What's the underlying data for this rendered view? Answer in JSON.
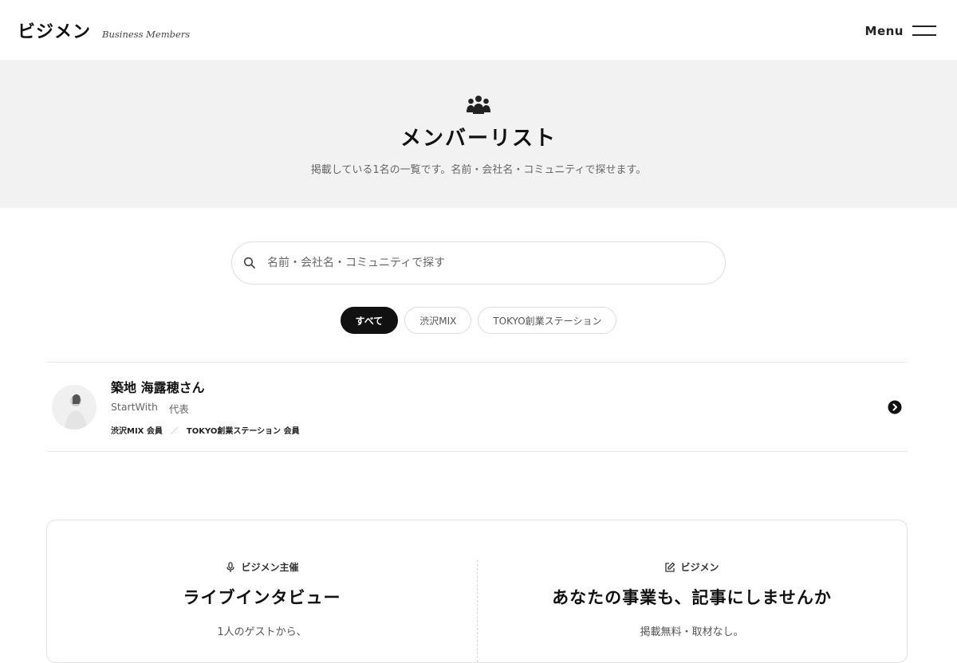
{
  "header": {
    "logo": "ビジメン",
    "tagline": "Business Members",
    "menu_label": "Menu"
  },
  "hero": {
    "title": "メンバーリスト",
    "subtitle": "掲載している1名の一覧です。名前・会社名・コミュニティで探せます。"
  },
  "search": {
    "placeholder": "名前・会社名・コミュニティで探す",
    "value": ""
  },
  "filters": [
    {
      "label": "すべて",
      "active": true
    },
    {
      "label": "渋沢MIX",
      "active": false
    },
    {
      "label": "TOKYO創業ステーション",
      "active": false
    }
  ],
  "members": [
    {
      "name": "築地 海露穂さん",
      "company": "StartWith",
      "role": "代表",
      "tags": [
        "渋沢MIX 会員",
        "TOKYO創業ステーション 会員"
      ],
      "tag_separator": "／"
    }
  ],
  "promo": {
    "left": {
      "kicker": "ビジメン主催",
      "title": "ライブインタビュー",
      "text": "1人のゲストから、"
    },
    "right": {
      "kicker": "ビジメン",
      "title": "あなたの事業も、記事にしませんか",
      "text": "掲載無料・取材なし。"
    }
  },
  "colors": {
    "hero_bg": "#f2f2f2",
    "active_chip": "#111111",
    "text_primary": "#111111"
  },
  "icons": {
    "hero": "group-icon",
    "search": "search-icon",
    "arrow": "chevron-right-circle-icon",
    "promo_left": "microphone-icon",
    "promo_right": "edit-icon"
  }
}
